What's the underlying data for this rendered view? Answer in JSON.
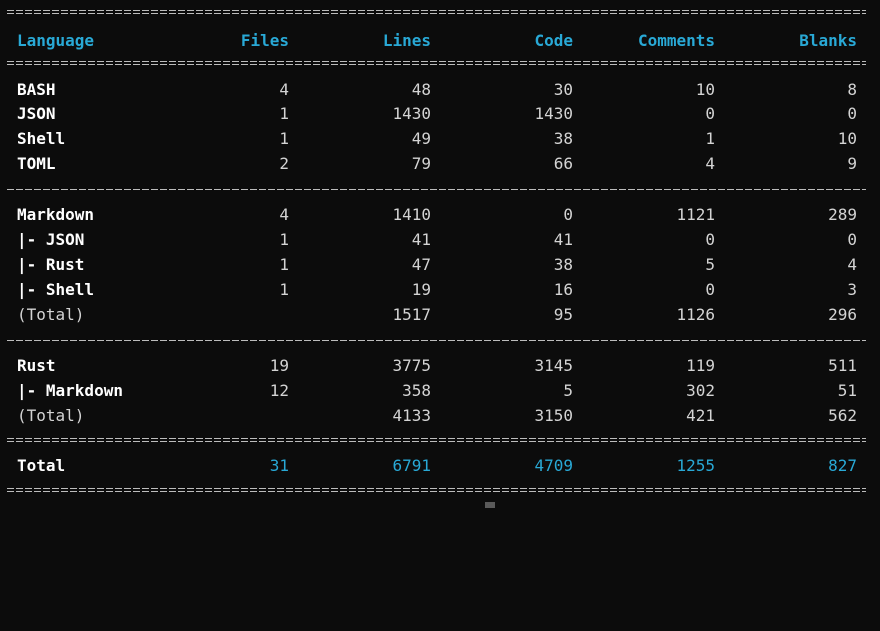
{
  "header": [
    "Language",
    "Files",
    "Lines",
    "Code",
    "Comments",
    "Blanks"
  ],
  "rows": [
    {
      "lang": "BASH",
      "files": "4",
      "lines": "48",
      "code": "30",
      "comments": "10",
      "blanks": "8"
    },
    {
      "lang": "JSON",
      "files": "1",
      "lines": "1430",
      "code": "1430",
      "comments": "0",
      "blanks": "0"
    },
    {
      "lang": "Shell",
      "files": "1",
      "lines": "49",
      "code": "38",
      "comments": "1",
      "blanks": "10"
    },
    {
      "lang": "TOML",
      "files": "2",
      "lines": "79",
      "code": "66",
      "comments": "4",
      "blanks": "9"
    },
    {
      "lang": "Markdown",
      "files": "4",
      "lines": "1410",
      "code": "0",
      "comments": "1121",
      "blanks": "289"
    },
    {
      "lang": "|- JSON",
      "files": "1",
      "lines": "41",
      "code": "41",
      "comments": "0",
      "blanks": "0"
    },
    {
      "lang": "|- Rust",
      "files": "1",
      "lines": "47",
      "code": "38",
      "comments": "5",
      "blanks": "4"
    },
    {
      "lang": "|- Shell",
      "files": "1",
      "lines": "19",
      "code": "16",
      "comments": "0",
      "blanks": "3"
    },
    {
      "lang": "(Total)",
      "files": "",
      "lines": "1517",
      "code": "95",
      "comments": "1126",
      "blanks": "296"
    },
    {
      "lang": "Rust",
      "files": "19",
      "lines": "3775",
      "code": "3145",
      "comments": "119",
      "blanks": "511"
    },
    {
      "lang": "|- Markdown",
      "files": "12",
      "lines": "358",
      "code": "5",
      "comments": "302",
      "blanks": "51"
    },
    {
      "lang": "(Total)",
      "files": "",
      "lines": "4133",
      "code": "3150",
      "comments": "421",
      "blanks": "562"
    }
  ],
  "total": {
    "lang": "Total",
    "files": "31",
    "lines": "6791",
    "code": "4709",
    "comments": "1255",
    "blanks": "827"
  },
  "colors": {
    "accent": "#29a9d6",
    "background": "#0c0c0c",
    "text": "#d4d4d4"
  }
}
